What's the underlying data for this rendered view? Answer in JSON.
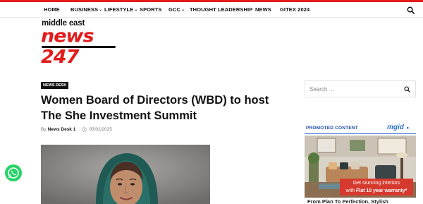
{
  "nav": {
    "items": [
      {
        "label": "HOME"
      },
      {
        "label": "BUSINESS"
      },
      {
        "label": "LIFESTYLE"
      },
      {
        "label": "SPORTS"
      },
      {
        "label": "GCC"
      },
      {
        "label": "THOUGHT LEADERSHIP"
      },
      {
        "label": "NEWS"
      },
      {
        "label": "GITEX 2024"
      }
    ]
  },
  "logo": {
    "top": "middle east",
    "main": "news 247"
  },
  "article": {
    "category": "NEWS DESK",
    "title": "Women Board of Directors (WBD) to host The She Investment Summit",
    "by": "By",
    "author": "News Desk 1",
    "date": "05/02/2025"
  },
  "sidebar": {
    "search_placeholder": "Search …",
    "promoted_label": "PROMOTED CONTENT",
    "mgid_logo": "mgid",
    "ad": {
      "banner_line1": "Get stunning interiors",
      "banner_line2_prefix": "with ",
      "banner_line2_bold": "Flat 10 year warranty*",
      "caption": "From Plan To Perfection, Stylish"
    }
  },
  "colors": {
    "accent": "#e21b1b",
    "promo_blue": "#1f4fa8",
    "whatsapp": "#25d366"
  }
}
